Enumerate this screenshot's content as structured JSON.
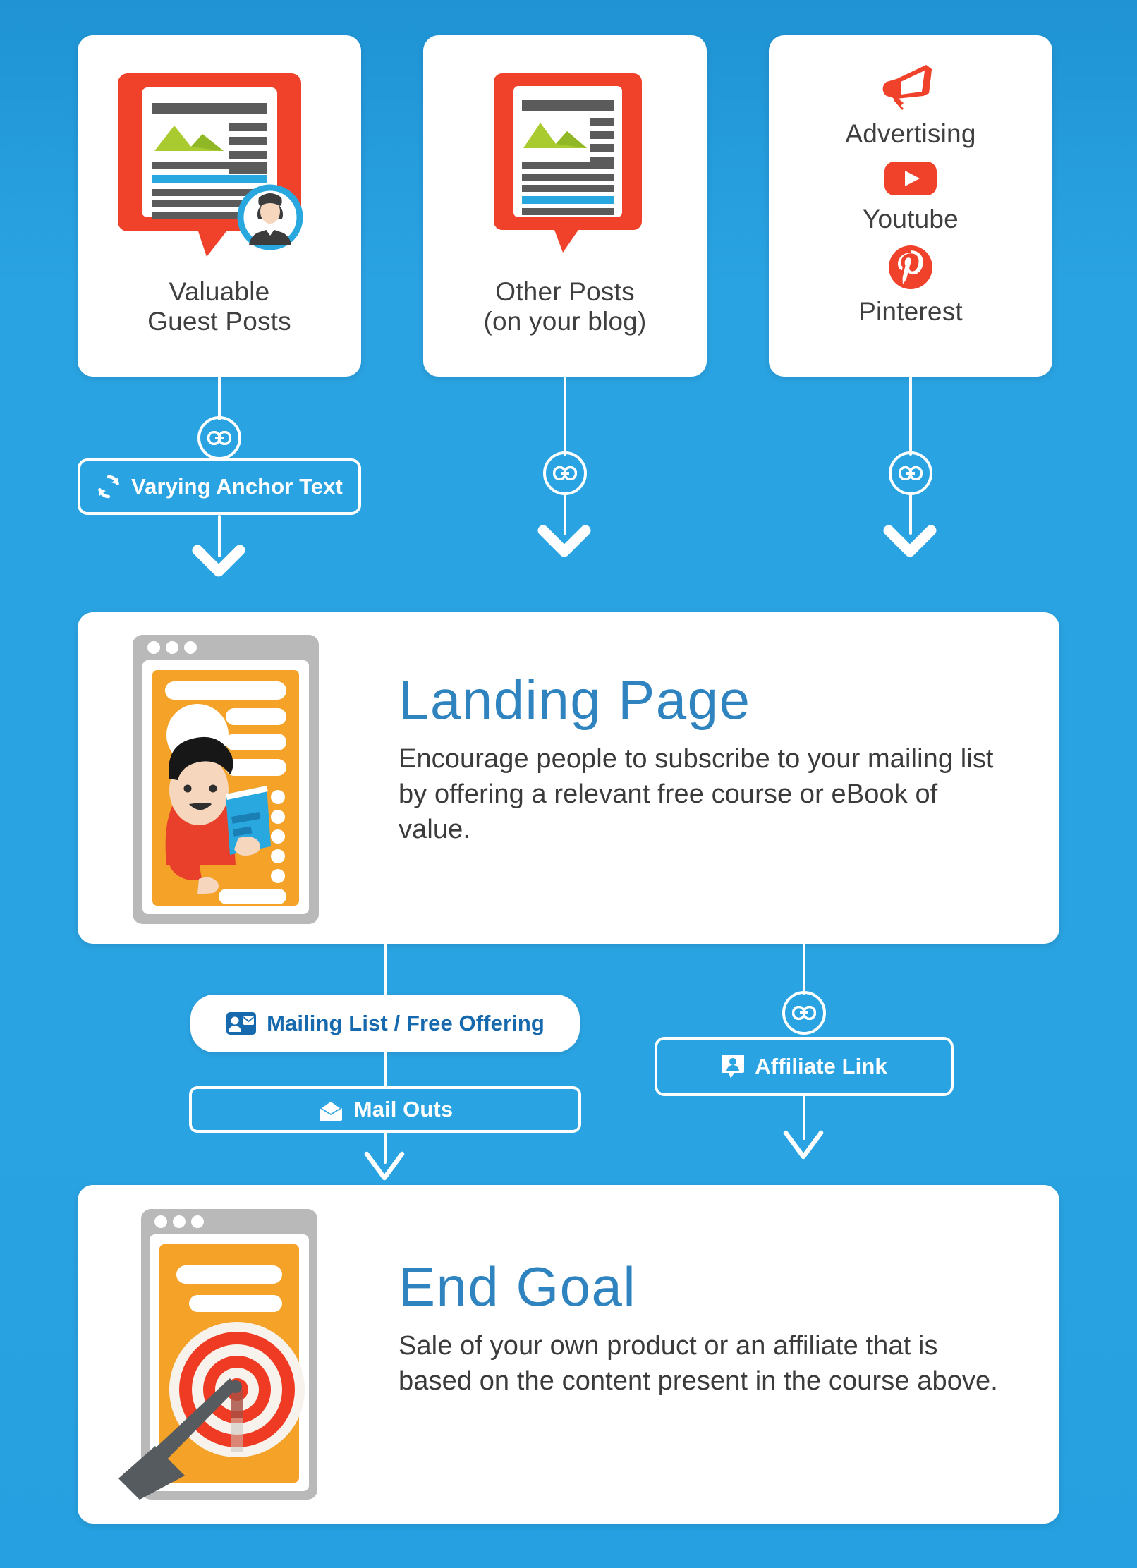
{
  "theme": {
    "background_blue": "#2aa3e2",
    "card_white": "#ffffff",
    "accent_red": "#f0412a",
    "title_blue": "#2f84c0",
    "chip_blue_text": "#1669ad",
    "body_gray": "#3b3b3b",
    "orange": "#f5a229",
    "green": "#a9cb2f",
    "link_blue": "#29a8e0"
  },
  "sources": [
    {
      "id": "valuable-guest-posts",
      "caption_line1": "Valuable",
      "caption_line2": "Guest Posts",
      "icon": "document-post-with-author-avatar-icon"
    },
    {
      "id": "other-posts",
      "caption_line1": "Other Posts",
      "caption_line2": "(on your blog)",
      "icon": "document-post-icon"
    }
  ],
  "social_card": {
    "items": [
      {
        "label": "Advertising",
        "icon": "megaphone-icon"
      },
      {
        "label": "Youtube",
        "icon": "youtube-icon"
      },
      {
        "label": "Pinterest",
        "icon": "pinterest-icon"
      }
    ]
  },
  "connectors": {
    "anchor_text": {
      "label": "Varying Anchor Text",
      "icon": "refresh-sync-icon",
      "badge_icon": "link-icon"
    },
    "other_posts_link": {
      "badge_icon": "link-icon"
    },
    "social_link": {
      "badge_icon": "link-icon"
    },
    "mailing_list": {
      "label": "Mailing List / Free Offering",
      "icon": "contact-card-mail-icon"
    },
    "mail_outs": {
      "label": "Mail Outs",
      "icon": "open-envelope-icon"
    },
    "affiliate_link": {
      "label": "Affiliate Link",
      "icon": "contact-person-icon",
      "badge_icon": "link-icon"
    }
  },
  "sections": [
    {
      "id": "landing-page",
      "title": "Landing Page",
      "description": "Encourage people to subscribe to your mailing list by offering a relevant free course or eBook of value.",
      "visual": "browser-window-with-person-holding-book-illustration"
    },
    {
      "id": "end-goal",
      "title": "End Goal",
      "description": "Sale of your own product or an affiliate that is based on the content present in the course above.",
      "visual": "browser-window-with-target-and-arrow-illustration"
    }
  ]
}
